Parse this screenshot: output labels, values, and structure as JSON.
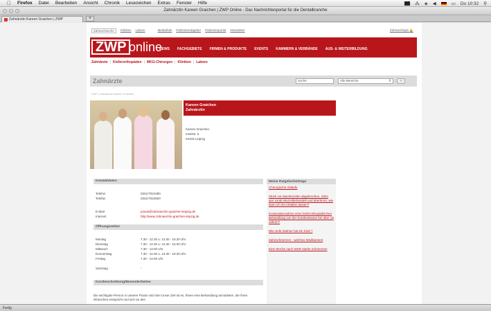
{
  "os_menubar": {
    "app_name": "Firefox",
    "items": [
      "Datei",
      "Bearbeiten",
      "Ansicht",
      "Chronik",
      "Lesezeichen",
      "Extras",
      "Fenster",
      "Hilfe"
    ],
    "clock": "Do 10:32"
  },
  "window": {
    "title": "Zahnärztin Kareen Graichen | ZWP Online - Das Nachrichtenportal für die Dentalbranche"
  },
  "tab": {
    "label": "Zahnärztin Kareen Graichen | ZWP",
    "new_tab_label": "+"
  },
  "site": {
    "top_links": [
      "Zahnarztsuche",
      "Kliniken",
      "Labore",
      "Mediathek",
      "Patientenratgeber",
      "Patientenportal",
      "Newsletter"
    ],
    "login": "Zahnarztlogin",
    "logo_main": "ZWP",
    "logo_online": "online",
    "main_nav": [
      "NEWS",
      "FACHGEBIETE",
      "FIRMEN & PRODUKTE",
      "EVENTS",
      "KAMMERN & VERBÄNDE",
      "AUS- & WEITERBILDUNG"
    ],
    "sub_nav": [
      "Zahnärzte",
      "Kieferorthopäden",
      "MKG-Chirurgen",
      "Kliniken",
      "Labore"
    ],
    "sub_nav_sep": "|",
    "section_title": "Zahnärzte",
    "search_value": "Suche",
    "select_value": "Alle Bereiche",
    "select_arrow": "⇕",
    "search_button": "»",
    "breadcrumb": "ZWP | Zahnärzte Kareen Graichen"
  },
  "profile": {
    "name": "Kareen Graichen",
    "role": "Zahnärztin",
    "address": [
      "Kareen Graichen",
      "Inselstr. 6",
      "04103 Leipzig"
    ]
  },
  "contact": {
    "header": "Kontaktdaten",
    "rows": [
      {
        "label": "Telefon",
        "value": "0341/7024480"
      },
      {
        "label": "Telefax",
        "value": "0341/7024820"
      },
      {
        "label": "E-Mail",
        "value": "praxis@zahnaerztin-graichen-leipzig.de"
      },
      {
        "label": "Internet",
        "value": "http://www.zahnaerztin-graichen-leipzig.de"
      }
    ]
  },
  "hours": {
    "header": "Öffnungszeiten",
    "rows": [
      {
        "day": "Montag",
        "time": "7.30 - 12.30 u. 13.30 - 18.30 Uhr"
      },
      {
        "day": "Dienstag",
        "time": "7.30 - 12.30 u. 13.30 - 16.00 Uhr"
      },
      {
        "day": "Mittwoch",
        "time": "7.30 - 13.00 Uhr"
      },
      {
        "day": "Donnerstag",
        "time": "7.30 - 12.30 u. 13.30 - 18.30 Uhr"
      },
      {
        "day": "Freitag",
        "time": "7.30 - 13.00 Uhr"
      },
      {
        "day": "Samstag",
        "time": "-"
      }
    ]
  },
  "description": {
    "header": "Kurzbeschreibung/Besonderheiten",
    "text": "Die wichtigste Person in unserer Praxis sind Sie! Unser Ziel ist es, Ihnen eine Behandlung anzubieten, die Ihren Wünschen entspricht und sich an den"
  },
  "sidebar": {
    "header": "Meine Ratgeberbeiträge",
    "items": [
      "Chirurgische Abläufe",
      "Stück von Backenzahn abgebrochen, Zahn war vorab Wurzelbehandelt und überkront, wie kann ich ihn erhalten lassen?",
      "Kostenübernahme einer kieferorthopädischen Behandlung von der Krankenkasse bei über 18 Jahren?",
      "Wie viele Zaehne hat ein Kind ?",
      "Zahnschmerzen - welches Medikament",
      "Eine Woche nach WSR starke Schmerzen"
    ]
  },
  "status": {
    "text": "Fertig"
  }
}
